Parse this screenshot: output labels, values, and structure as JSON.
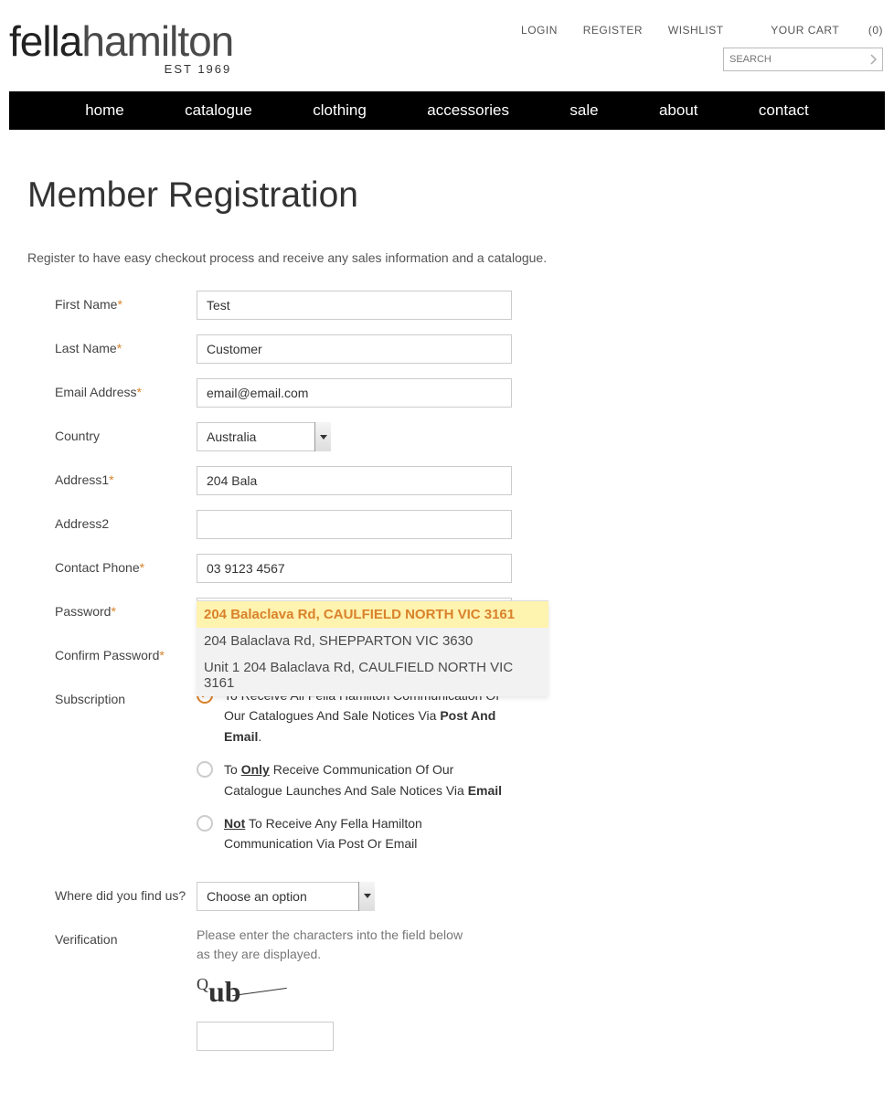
{
  "header": {
    "logo_bold": "fella",
    "logo_light": "hamilton",
    "logo_est": "EST 1969",
    "top_links": {
      "login": "LOGIN",
      "register": "REGISTER",
      "wishlist": "WISHLIST",
      "cart_label": "YOUR CART",
      "cart_count": "(0)"
    },
    "search_placeholder": "SEARCH"
  },
  "nav": {
    "home": "home",
    "catalogue": "catalogue",
    "clothing": "clothing",
    "accessories": "accessories",
    "sale": "sale",
    "about": "about",
    "contact": "contact"
  },
  "page": {
    "title": "Member Registration",
    "intro": "Register to have easy checkout process and receive any sales information and a catalogue."
  },
  "form": {
    "labels": {
      "first_name": "First Name",
      "last_name": "Last Name",
      "email": "Email Address",
      "country": "Country",
      "address1": "Address1",
      "address2": "Address2",
      "phone": "Contact Phone",
      "password": "Password",
      "confirm": "Confirm Password",
      "subscription": "Subscription",
      "find": "Where did you find us?",
      "verification": "Verification"
    },
    "values": {
      "first_name": "Test",
      "last_name": "Customer",
      "email": "email@email.com",
      "country": "Australia",
      "address1": "204 Bala",
      "address2": "",
      "phone": "03 9123 4567",
      "password": "••••",
      "confirm": "••••",
      "find": "Choose an option"
    },
    "subscription": {
      "opt1_pre": "To Receive All Fella Hamilton Communication Of Our Catalogues And Sale Notices Via ",
      "opt1_bold": "Post And Email",
      "opt2_pre": "To ",
      "opt2_ul": "Only",
      "opt2_post": " Receive Communication Of Our Catalogue Launches And Sale Notices Via ",
      "opt2_bold": "Email",
      "opt3_ul": "Not",
      "opt3_post": " To Receive Any Fella Hamilton Communication Via Post Or Email"
    },
    "verification_text": "Please enter the characters into the field below as they are displayed.",
    "captcha_text": "Qub"
  },
  "autocomplete": {
    "item1": "204 Balaclava Rd, CAULFIELD NORTH VIC 3161",
    "item2": "204 Balaclava Rd, SHEPPARTON VIC 3630",
    "item3": "Unit 1 204 Balaclava Rd, CAULFIELD NORTH VIC 3161"
  }
}
